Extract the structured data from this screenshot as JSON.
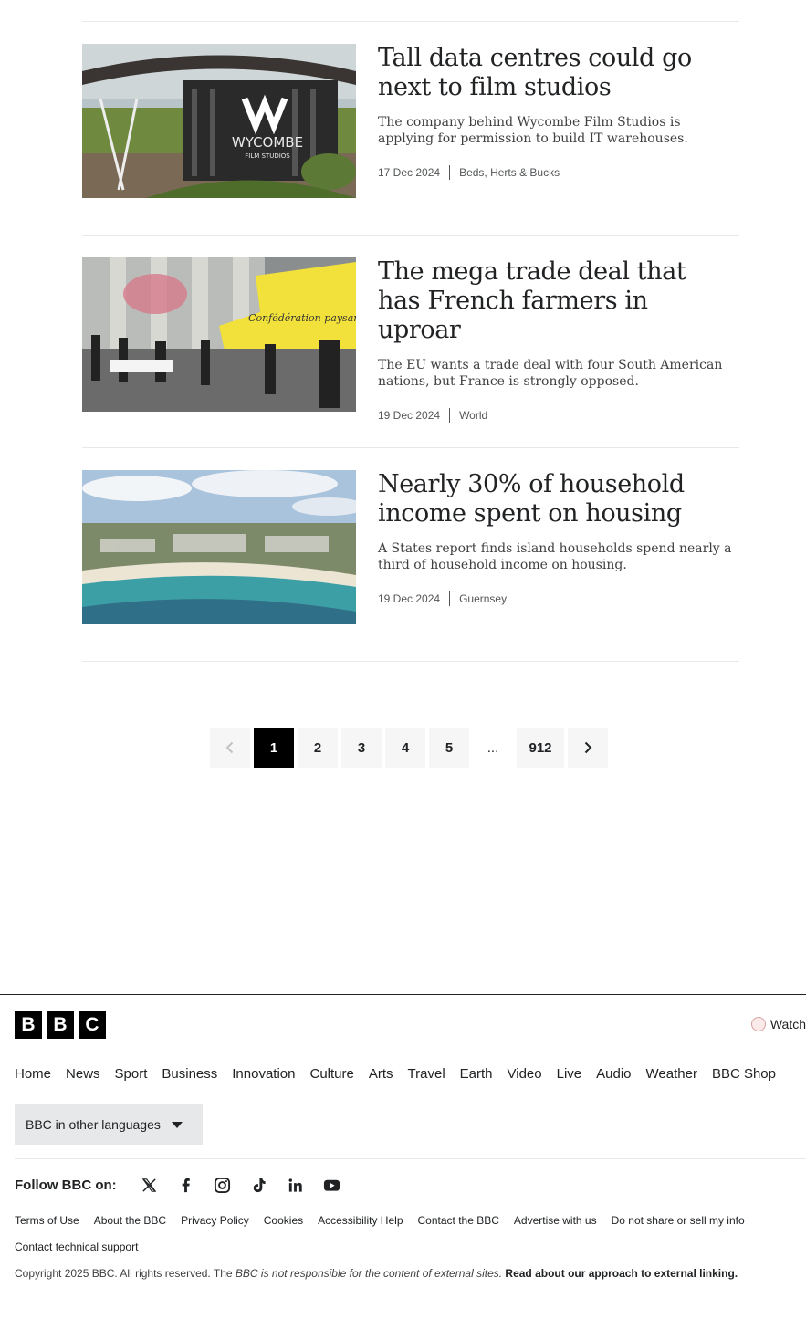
{
  "articles": [
    {
      "headline": "Tall data centres could go next to film studios",
      "summary": "The company behind Wycombe Film Studios is applying for permission to build IT warehouses.",
      "date": "17 Dec 2024",
      "section": "Beds, Herts & Bucks",
      "thumb_text": "WYCOMBE",
      "thumb_subtext": "FILM STUDIOS"
    },
    {
      "headline": "The mega trade deal that has French farmers in uproar",
      "summary": "The EU wants a trade deal with four South American nations, but France is strongly opposed.",
      "date": "19 Dec 2024",
      "section": "World",
      "thumb_text": "Confédération paysanne"
    },
    {
      "headline": "Nearly 30% of household income spent on housing",
      "summary": "A States report finds island households spend nearly a third of household income on housing.",
      "date": "19 Dec 2024",
      "section": "Guernsey"
    }
  ],
  "pagination": {
    "current": "1",
    "pages": [
      "2",
      "3",
      "4",
      "5"
    ],
    "ellipsis": "...",
    "last": "912"
  },
  "footer": {
    "logo_letters": [
      "B",
      "B",
      "C"
    ],
    "watch_label": "Watch",
    "nav": [
      "Home",
      "News",
      "Sport",
      "Business",
      "Innovation",
      "Culture",
      "Arts",
      "Travel",
      "Earth",
      "Video",
      "Live",
      "Audio",
      "Weather",
      "BBC Shop"
    ],
    "languages_label": "BBC in other languages",
    "follow_label": "Follow BBC on:",
    "social": [
      "x-icon",
      "facebook-icon",
      "instagram-icon",
      "tiktok-icon",
      "linkedin-icon",
      "youtube-icon"
    ],
    "links": [
      "Terms of Use",
      "About the BBC",
      "Privacy Policy",
      "Cookies",
      "Accessibility Help",
      "Contact the BBC",
      "Advertise with us",
      "Do not share or sell my info",
      "Contact technical support"
    ],
    "copyright_prefix": "Copyright 2025 BBC. All rights reserved.  The ",
    "copyright_bbc": "BBC",
    "copyright_middle": " is not responsible for the content of external sites. ",
    "copyright_link": "Read about our approach to external linking."
  }
}
